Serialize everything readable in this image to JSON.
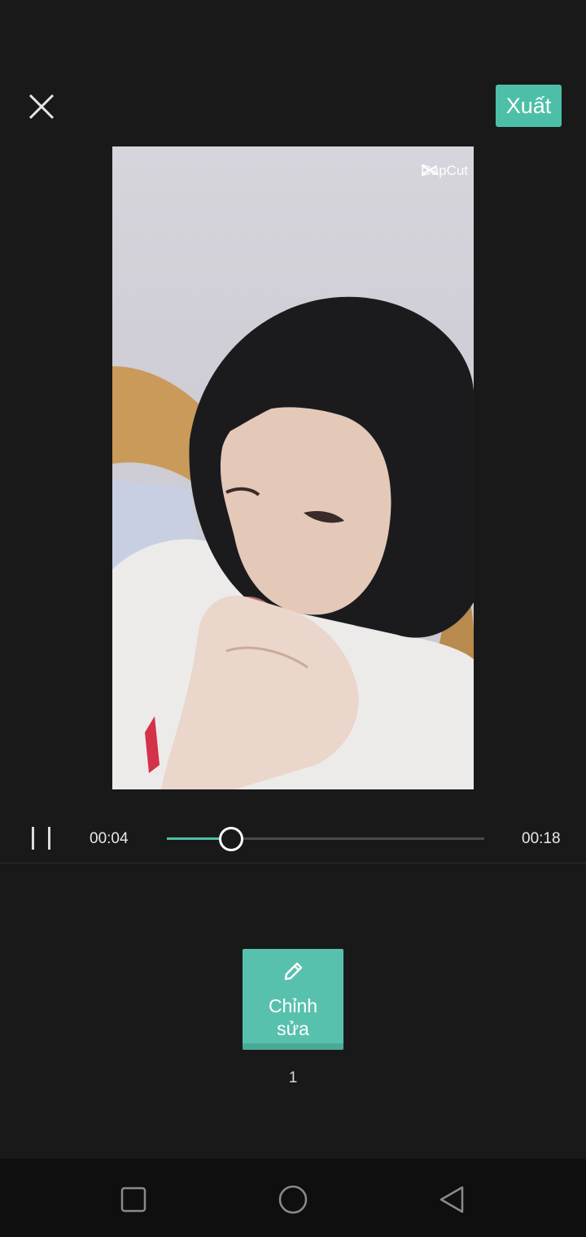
{
  "toolbar": {
    "close_icon": "close-icon",
    "export_label": "Xuất",
    "accent_color": "#4dbfa8"
  },
  "preview": {
    "watermark_text": "CapCut",
    "watermark_icon": "capcut-logo-icon"
  },
  "player": {
    "current_time": "00:04",
    "total_time": "00:18",
    "progress": 0.2,
    "pause_icon": "pause-icon"
  },
  "edit": {
    "label_line1": "Chỉnh",
    "label_line2": "sửa",
    "icon": "pencil-icon",
    "count": "1"
  },
  "system_nav": {
    "recents_icon": "square-icon",
    "home_icon": "circle-icon",
    "back_icon": "triangle-back-icon"
  }
}
